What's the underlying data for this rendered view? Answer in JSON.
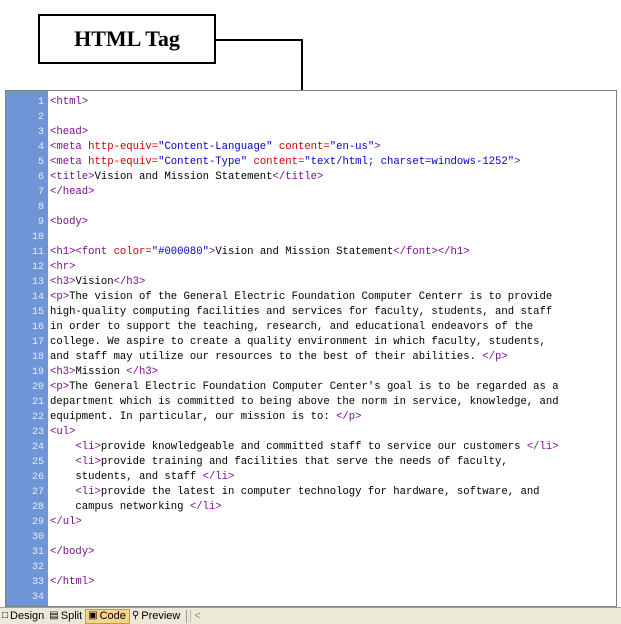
{
  "callout": {
    "label": "HTML Tag"
  },
  "editor": {
    "lines": [
      {
        "n": "1",
        "segments": [
          {
            "t": "<html>",
            "c": "tag"
          }
        ]
      },
      {
        "n": "2",
        "segments": []
      },
      {
        "n": "3",
        "segments": [
          {
            "t": "<head>",
            "c": "tag"
          }
        ]
      },
      {
        "n": "4",
        "segments": [
          {
            "t": "<meta ",
            "c": "tag"
          },
          {
            "t": "http-equiv=",
            "c": "attr"
          },
          {
            "t": "\"Content-Language\"",
            "c": "val"
          },
          {
            "t": " content=",
            "c": "attr"
          },
          {
            "t": "\"en-us\"",
            "c": "val"
          },
          {
            "t": ">",
            "c": "tag"
          }
        ]
      },
      {
        "n": "5",
        "segments": [
          {
            "t": "<meta ",
            "c": "tag"
          },
          {
            "t": "http-equiv=",
            "c": "attr"
          },
          {
            "t": "\"Content-Type\"",
            "c": "val"
          },
          {
            "t": " content=",
            "c": "attr"
          },
          {
            "t": "\"text/html; charset=windows-1252\"",
            "c": "val"
          },
          {
            "t": ">",
            "c": "tag"
          }
        ]
      },
      {
        "n": "6",
        "segments": [
          {
            "t": "<title>",
            "c": "tag"
          },
          {
            "t": "Vision and Mission Statement",
            "c": "txt"
          },
          {
            "t": "</title>",
            "c": "tag"
          }
        ]
      },
      {
        "n": "7",
        "segments": [
          {
            "t": "</head>",
            "c": "tag"
          }
        ]
      },
      {
        "n": "8",
        "segments": []
      },
      {
        "n": "9",
        "segments": [
          {
            "t": "<body>",
            "c": "tag"
          }
        ]
      },
      {
        "n": "10",
        "segments": []
      },
      {
        "n": "11",
        "segments": [
          {
            "t": "<h1><font ",
            "c": "tag"
          },
          {
            "t": "color=",
            "c": "attr"
          },
          {
            "t": "\"#000080\"",
            "c": "val"
          },
          {
            "t": ">",
            "c": "tag"
          },
          {
            "t": "Vision and Mission Statement",
            "c": "txt"
          },
          {
            "t": "</font></h1>",
            "c": "tag"
          }
        ]
      },
      {
        "n": "12",
        "segments": [
          {
            "t": "<hr>",
            "c": "tag"
          }
        ]
      },
      {
        "n": "13",
        "segments": [
          {
            "t": "<h3>",
            "c": "tag"
          },
          {
            "t": "Vision",
            "c": "txt"
          },
          {
            "t": "</h3>",
            "c": "tag"
          }
        ]
      },
      {
        "n": "14",
        "segments": [
          {
            "t": "<p>",
            "c": "tag"
          },
          {
            "t": "The vision of the General Electric Foundation Computer Centerr is to provide",
            "c": "txt"
          }
        ]
      },
      {
        "n": "15",
        "segments": [
          {
            "t": "high-quality computing facilities and services for faculty, students, and staff",
            "c": "txt"
          }
        ]
      },
      {
        "n": "16",
        "segments": [
          {
            "t": "in order to support the teaching, research, and educational endeavors of the",
            "c": "txt"
          }
        ]
      },
      {
        "n": "17",
        "segments": [
          {
            "t": "college. We aspire to create a quality environment in which faculty, students,",
            "c": "txt"
          }
        ]
      },
      {
        "n": "18",
        "segments": [
          {
            "t": "and staff may utilize our resources to the best of their abilities. ",
            "c": "txt"
          },
          {
            "t": "</p>",
            "c": "tag"
          }
        ]
      },
      {
        "n": "19",
        "segments": [
          {
            "t": "<h3>",
            "c": "tag"
          },
          {
            "t": "Mission ",
            "c": "txt"
          },
          {
            "t": "</h3>",
            "c": "tag"
          }
        ]
      },
      {
        "n": "20",
        "segments": [
          {
            "t": "<p>",
            "c": "tag"
          },
          {
            "t": "The General Electric Foundation Computer Center's goal is to be regarded as a",
            "c": "txt"
          }
        ]
      },
      {
        "n": "21",
        "segments": [
          {
            "t": "department which is committed to being above the norm in service, knowledge, and",
            "c": "txt"
          }
        ]
      },
      {
        "n": "22",
        "segments": [
          {
            "t": "equipment. In particular, our mission is to: ",
            "c": "txt"
          },
          {
            "t": "</p>",
            "c": "tag"
          }
        ]
      },
      {
        "n": "23",
        "segments": [
          {
            "t": "<ul>",
            "c": "tag"
          }
        ]
      },
      {
        "n": "24",
        "segments": [
          {
            "t": "    ",
            "c": "txt"
          },
          {
            "t": "<li>",
            "c": "tag"
          },
          {
            "t": "provide knowledgeable and committed staff to service our customers ",
            "c": "txt"
          },
          {
            "t": "</li>",
            "c": "tag"
          }
        ]
      },
      {
        "n": "25",
        "segments": [
          {
            "t": "    ",
            "c": "txt"
          },
          {
            "t": "<li>",
            "c": "tag"
          },
          {
            "t": "provide training and facilities that serve the needs of faculty,",
            "c": "txt"
          }
        ]
      },
      {
        "n": "26",
        "segments": [
          {
            "t": "    students, and staff ",
            "c": "txt"
          },
          {
            "t": "</li>",
            "c": "tag"
          }
        ]
      },
      {
        "n": "27",
        "segments": [
          {
            "t": "    ",
            "c": "txt"
          },
          {
            "t": "<li>",
            "c": "tag"
          },
          {
            "t": "provide the latest in computer technology for hardware, software, and",
            "c": "txt"
          }
        ]
      },
      {
        "n": "28",
        "segments": [
          {
            "t": "    campus networking ",
            "c": "txt"
          },
          {
            "t": "</li>",
            "c": "tag"
          }
        ]
      },
      {
        "n": "29",
        "segments": [
          {
            "t": "</ul>",
            "c": "tag"
          }
        ]
      },
      {
        "n": "30",
        "segments": []
      },
      {
        "n": "31",
        "segments": [
          {
            "t": "</body>",
            "c": "tag"
          }
        ]
      },
      {
        "n": "32",
        "segments": []
      },
      {
        "n": "33",
        "segments": [
          {
            "t": "</html>",
            "c": "tag"
          }
        ]
      },
      {
        "n": "34",
        "segments": []
      }
    ]
  },
  "tabs": {
    "design": "Design",
    "split": "Split",
    "code": "Code",
    "preview": "Preview",
    "active": "Code"
  },
  "icons": {
    "design": "design-icon",
    "split": "split-icon",
    "code": "code-icon",
    "preview": "preview-icon",
    "scroll_left": "scroll-left-arrow-icon"
  },
  "colors": {
    "gutter": "#6f95d6",
    "tag": "#7a0f8e",
    "attribute": "#cc0000",
    "value": "#0000cc",
    "active_tab": "#f6d58a"
  }
}
